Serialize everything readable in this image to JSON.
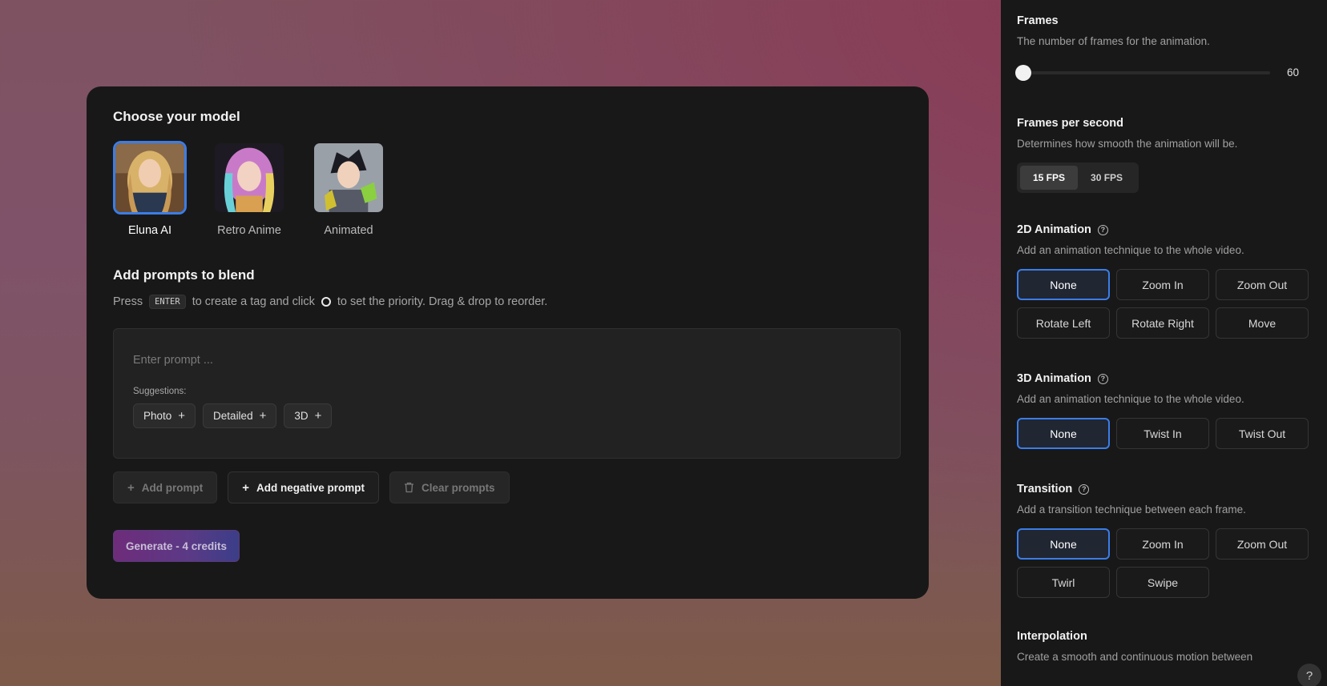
{
  "main": {
    "model_title": "Choose your model",
    "models": [
      {
        "label": "Eluna AI",
        "selected": true
      },
      {
        "label": "Retro Anime",
        "selected": false
      },
      {
        "label": "Animated",
        "selected": false
      }
    ],
    "prompts_title": "Add prompts to blend",
    "hint": {
      "press": "Press",
      "key": "ENTER",
      "mid": "to create a tag and click",
      "end": "to set the priority. Drag & drop to reorder."
    },
    "prompt_placeholder": "Enter prompt ...",
    "suggestions_label": "Suggestions:",
    "suggestions": [
      "Photo",
      "Detailed",
      "3D"
    ],
    "actions": {
      "add_prompt": "Add prompt",
      "add_negative": "Add negative prompt",
      "clear": "Clear prompts"
    },
    "generate_label": "Generate - 4 credits"
  },
  "panel": {
    "frames": {
      "title": "Frames",
      "desc": "The number of frames for the animation.",
      "value": "60",
      "fill_fraction": 0.0
    },
    "fps": {
      "title": "Frames per second",
      "desc": "Determines how smooth the animation will be.",
      "options": [
        "15 FPS",
        "30 FPS"
      ],
      "selected": "15 FPS"
    },
    "anim2d": {
      "title": "2D Animation",
      "desc": "Add an animation technique to the whole video.",
      "options": [
        "None",
        "Zoom In",
        "Zoom Out",
        "Rotate Left",
        "Rotate Right",
        "Move"
      ],
      "selected": "None"
    },
    "anim3d": {
      "title": "3D Animation",
      "desc": "Add an animation technique to the whole video.",
      "options": [
        "None",
        "Twist In",
        "Twist Out"
      ],
      "selected": "None"
    },
    "transition": {
      "title": "Transition",
      "desc": "Add a transition technique between each frame.",
      "options": [
        "None",
        "Zoom In",
        "Zoom Out",
        "Twirl",
        "Swipe"
      ],
      "selected": "None"
    },
    "interpolation": {
      "title": "Interpolation",
      "desc": "Create a smooth and continuous motion between"
    }
  },
  "help_label": "?",
  "colors": {
    "accent": "#3b7de8",
    "panel_bg": "#181818"
  }
}
